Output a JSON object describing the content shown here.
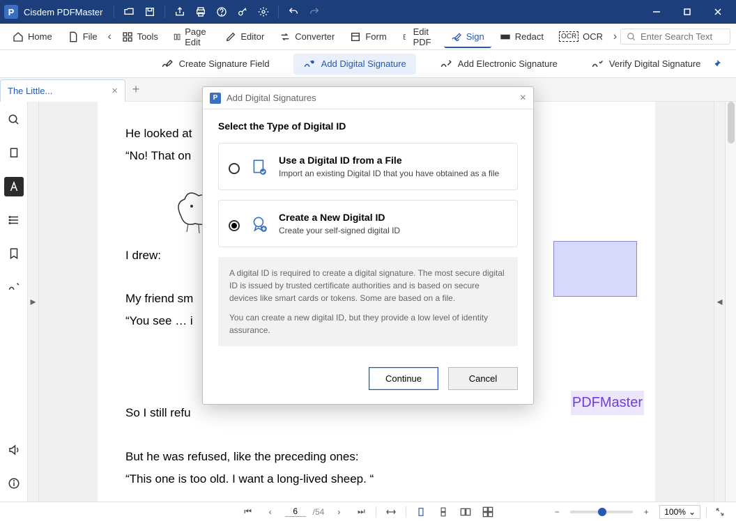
{
  "app": {
    "name": "Cisdem PDFMaster"
  },
  "maintoolbar": {
    "home": "Home",
    "file": "File",
    "tools": "Tools",
    "pageedit": "Page Edit",
    "editor": "Editor",
    "converter": "Converter",
    "form": "Form",
    "editpdf": "Edit PDF",
    "sign": "Sign",
    "redact": "Redact",
    "ocr": "OCR"
  },
  "search": {
    "placeholder": "Enter Search Text"
  },
  "subtoolbar": {
    "create_field": "Create Signature Field",
    "add_digital": "Add Digital Signature",
    "add_electronic": "Add Electronic Signature",
    "verify": "Verify Digital Signature"
  },
  "tab": {
    "label": "The Little..."
  },
  "document": {
    "lines": [
      "He looked at",
      "“No! That on",
      "I drew:",
      "My friend sm",
      "“You see … i",
      "So I still refu",
      "But he was refused, like the preceding ones:",
      "“This one is too old. I want a long-lived sheep. “"
    ],
    "watermark": "PDFMaster"
  },
  "status": {
    "page_current": "6",
    "page_total": "/54",
    "zoom": "100%"
  },
  "modal": {
    "title": "Add Digital Signatures",
    "heading": "Select the Type of Digital ID",
    "option1": {
      "title": "Use a Digital ID from a File",
      "desc": "Import an existing Digital ID that you have obtained as a file"
    },
    "option2": {
      "title": "Create a New Digital ID",
      "desc": "Create your self-signed digital ID"
    },
    "info1": "A digital ID is required to create a digital signature. The most secure digital ID is issued by trusted certificate authorities and is based on secure devices like smart cards or tokens. Some are based on a file.",
    "info2": "You can create a new digital ID, but they provide a low level of identity assurance.",
    "continue": "Continue",
    "cancel": "Cancel"
  }
}
